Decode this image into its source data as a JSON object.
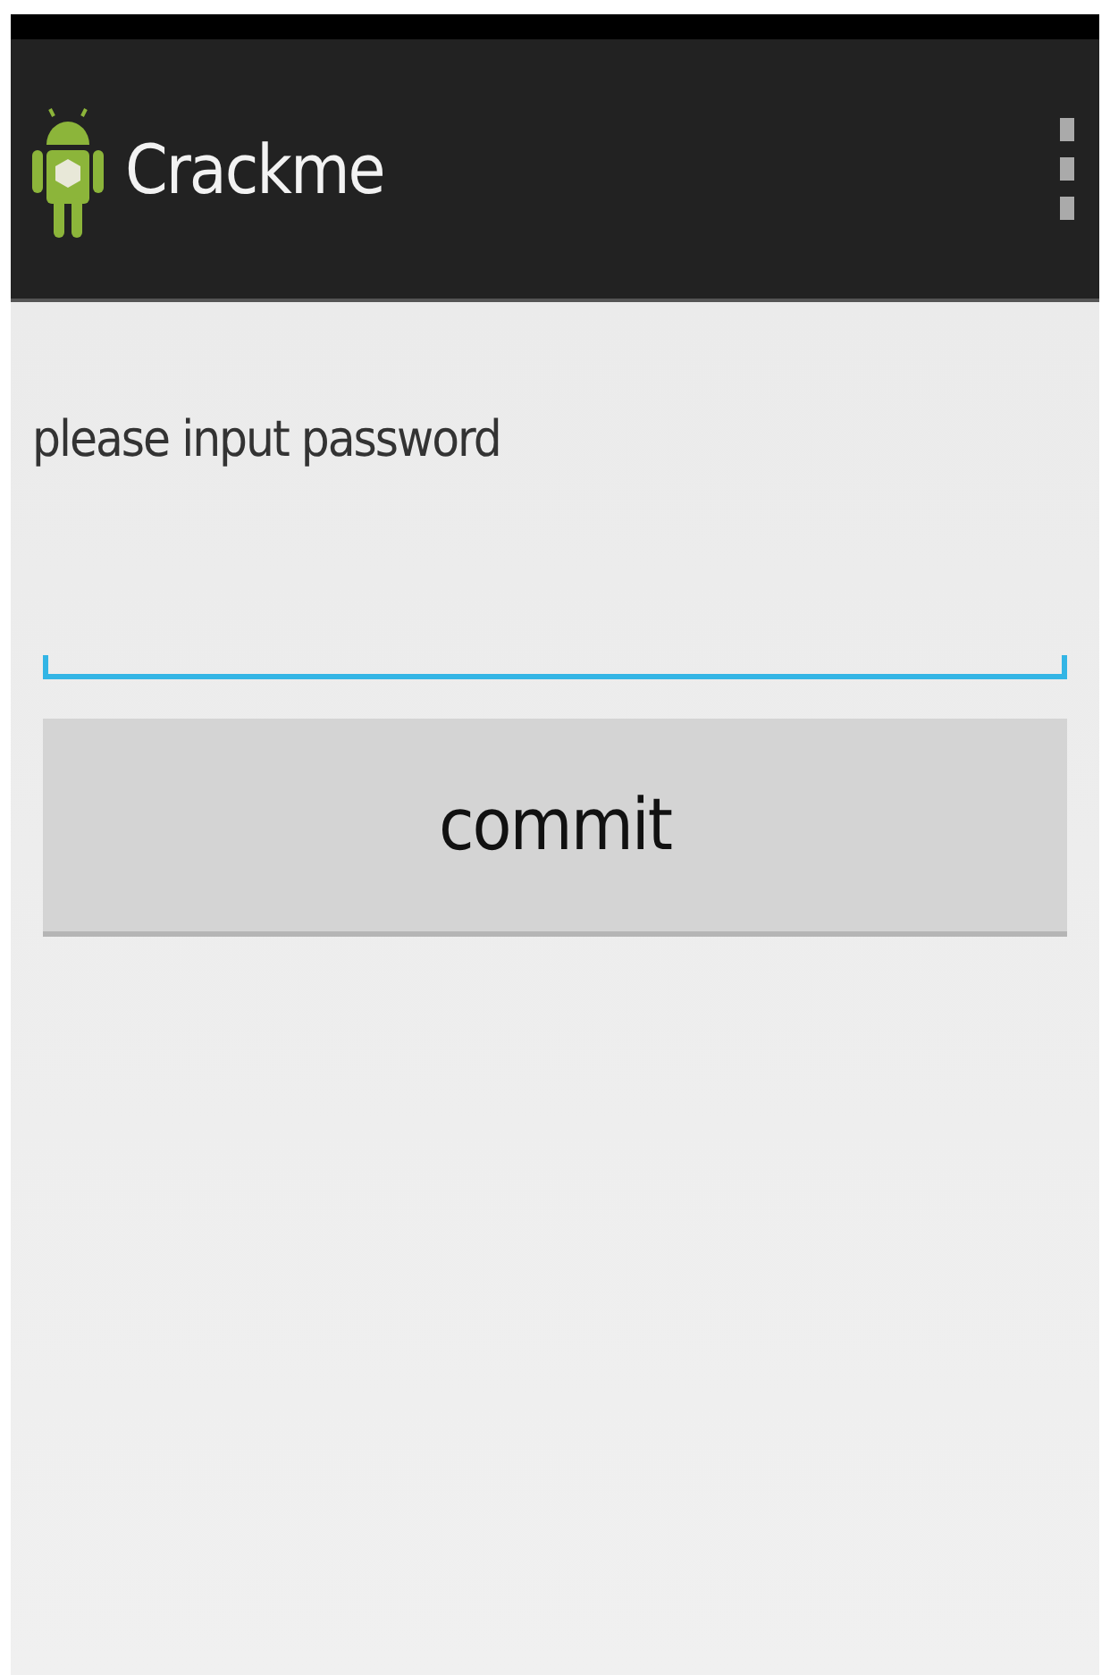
{
  "app_bar": {
    "title": "Crackme"
  },
  "prompt": "please input password",
  "commit_button": {
    "label": "commit"
  }
}
